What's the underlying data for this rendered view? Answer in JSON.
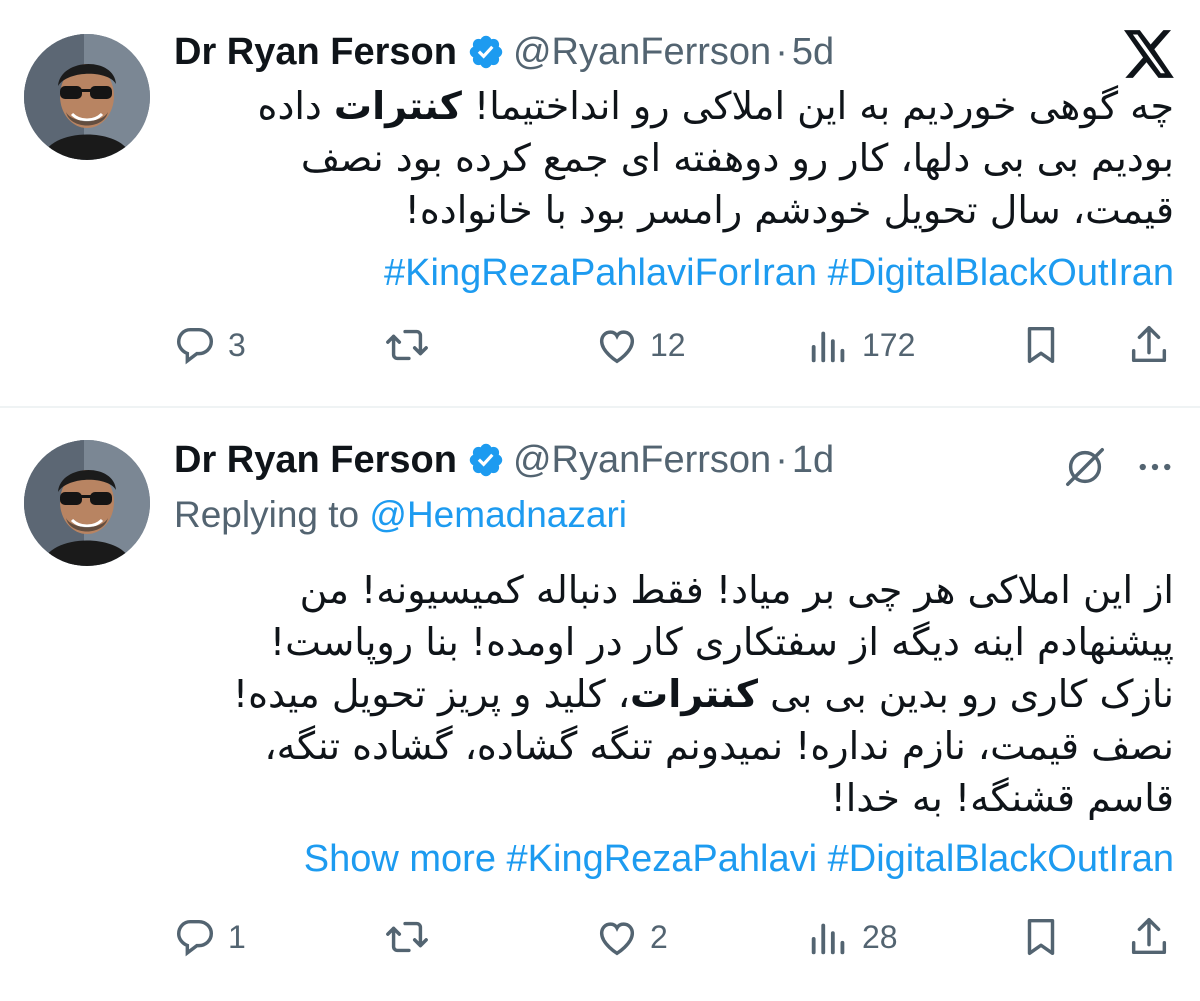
{
  "tweets": [
    {
      "display_name": "Dr Ryan Ferson",
      "handle": "@RyanFerrson",
      "separator": "·",
      "age": "5d",
      "avatar_icon": "user-avatar-photo",
      "text_parts": [
        "چه گوهی خوردیم به این املاکی رو انداختیما! ",
        "کنترات",
        " داده بودیم بی بی دلها، کار رو دوهفته ای جمع کرده بود   نصف قیمت، سال تحویل خودشم رامسر بود با خانواده!"
      ],
      "hashtags": "#KingRezaPahlaviForIran #DigitalBlackOutIran",
      "metrics": {
        "replies": "3",
        "retweets": "",
        "likes": "12",
        "views": "172"
      }
    },
    {
      "display_name": "Dr Ryan Ferson",
      "handle": "@RyanFerrson",
      "separator": "·",
      "age": "1d",
      "replying_prefix": "Replying to ",
      "replying_to": "@Hemadnazari",
      "text_parts": [
        "از این املاکی هر چی بر میاد! فقط دنباله کمیسیونه! من پیشنهادم اینه دیگه از سفتکاری کار در اومده! بنا روپاست! نازک کاری رو بدین بی بی ",
        "کنترات",
        "، کلید و پریز تحویل میده! نصف قیمت، نازم نداره! نمیدونم تنگه گشاده، گشاده تنگه، قاسم قشنگه! به خدا!"
      ],
      "show_more": "Show more",
      "hashtags": " #KingRezaPahlavi #DigitalBlackOutIran",
      "metrics": {
        "replies": "1",
        "retweets": "",
        "likes": "2",
        "views": "28"
      }
    }
  ],
  "icons": {
    "brand": "x-logo",
    "verified": "verified-badge-icon",
    "grok": "grok-icon",
    "more": "more-options-icon"
  },
  "colors": {
    "accent": "#1d9bf0",
    "secondary_text": "#536471",
    "primary_text": "#0f1419"
  }
}
